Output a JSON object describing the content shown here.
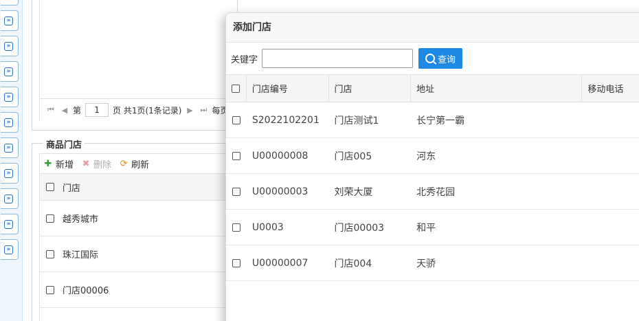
{
  "rail": {
    "buttons": 10,
    "icon": "expand-down-icon"
  },
  "top_panel": {
    "pager": {
      "page_prefix": "第",
      "page_value": "1",
      "page_suffix": "页 共1页(1条记录)",
      "trail": "每页"
    }
  },
  "goods_panel": {
    "title": "商品门店",
    "toolbar": {
      "add": "新增",
      "delete": "删除",
      "refresh": "刷新"
    },
    "column": "门店",
    "rows": [
      "越秀城市",
      "珠江国际",
      "门店00006"
    ]
  },
  "dialog": {
    "title": "添加门店",
    "keyword_label": "关键字",
    "keyword_value": "",
    "query_label": "查询",
    "columns": [
      "门店编号",
      "门店",
      "地址",
      "移动电话"
    ],
    "rows": [
      {
        "code": "S2022102201",
        "store": "门店测试1",
        "address": "长宁第一霸",
        "phone": ""
      },
      {
        "code": "U00000008",
        "store": "门店005",
        "address": "河东",
        "phone": ""
      },
      {
        "code": "U00000003",
        "store": "刘荣大厦",
        "address": "北秀花园",
        "phone": ""
      },
      {
        "code": "U0003",
        "store": "门店00003",
        "address": "和平",
        "phone": ""
      },
      {
        "code": "U00000007",
        "store": "门店004",
        "address": "天骄",
        "phone": ""
      }
    ]
  },
  "colors": {
    "accent": "#1e88e5",
    "rail": "#eef5fb"
  }
}
